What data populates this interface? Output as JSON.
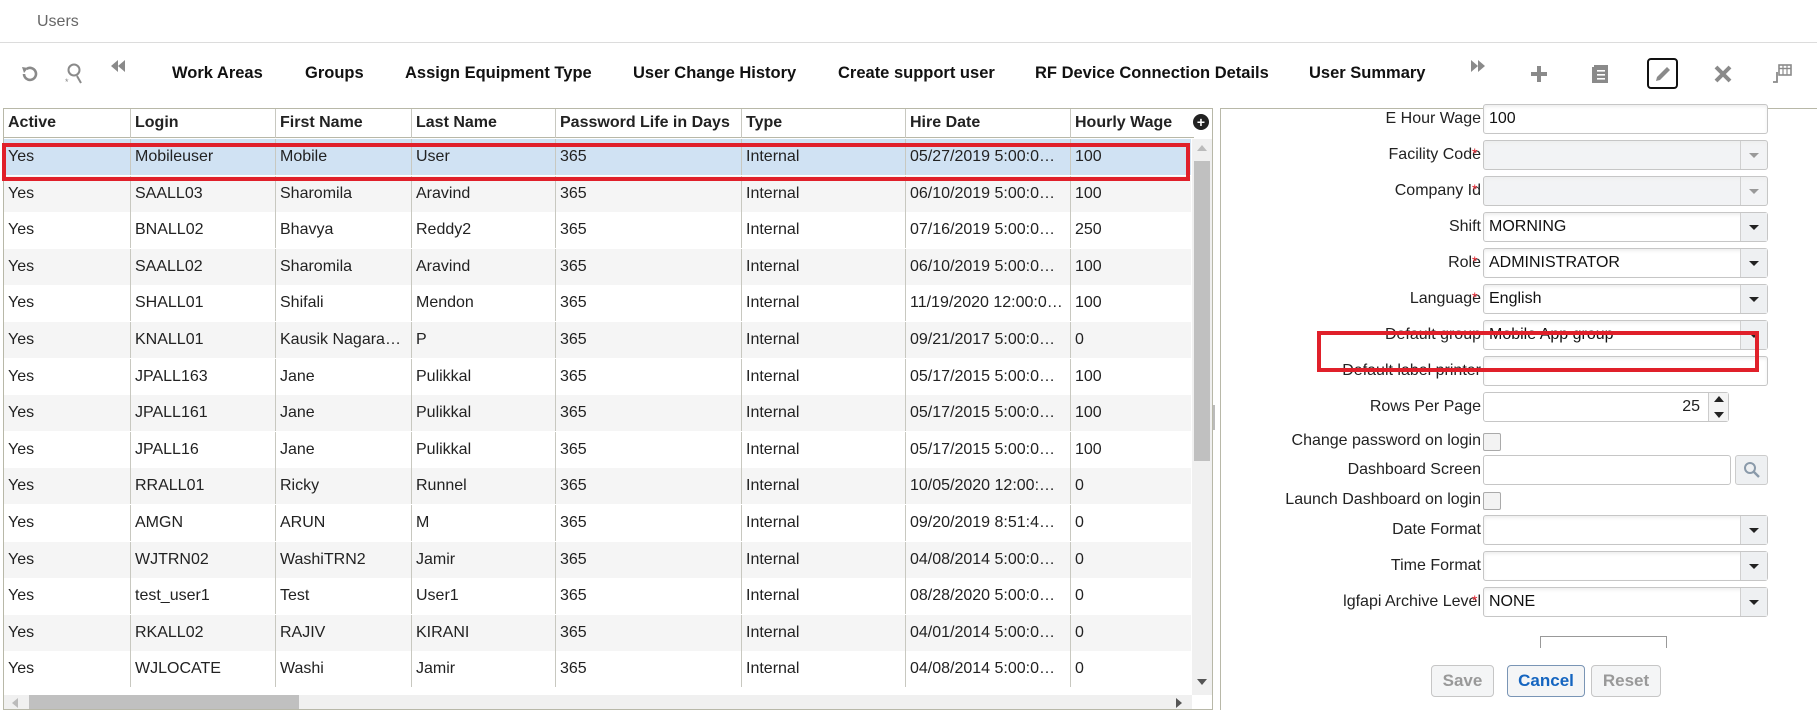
{
  "window": {
    "title": "Users"
  },
  "toolbar": {
    "left_icons": [
      {
        "name": "refresh-icon",
        "glyph": "↻"
      },
      {
        "name": "user-search-icon",
        "glyph": "⚲"
      },
      {
        "name": "scroll-left-icon",
        "glyph": "«"
      }
    ],
    "links": [
      "Work Areas",
      "Groups",
      "Assign Equipment Type",
      "User Change History",
      "Create support user",
      "RF Device Connection Details",
      "User Summary"
    ],
    "right_icons": [
      {
        "name": "scroll-right-icon",
        "glyph": "»"
      },
      {
        "name": "add-icon",
        "glyph": "+"
      },
      {
        "name": "details-icon",
        "glyph": "▤"
      },
      {
        "name": "edit-icon",
        "glyph": "✎",
        "active": true
      },
      {
        "name": "delete-icon",
        "glyph": "✕"
      },
      {
        "name": "grid-export-icon",
        "glyph": "⊞"
      }
    ]
  },
  "grid": {
    "columns": [
      "Active",
      "Login",
      "First Name",
      "Last Name",
      "Password Life in Days",
      "Type",
      "Hire Date",
      "Hourly Wage"
    ],
    "add_column_glyph": "+",
    "selected_row": 0,
    "rows": [
      [
        "Yes",
        "Mobileuser",
        "Mobile",
        "User",
        "365",
        "Internal",
        "05/27/2019 5:00:0…",
        "100"
      ],
      [
        "Yes",
        "SAALL03",
        "Sharomila",
        "Aravind",
        "365",
        "Internal",
        "06/10/2019 5:00:0…",
        "100"
      ],
      [
        "Yes",
        "BNALL02",
        "Bhavya",
        "Reddy2",
        "365",
        "Internal",
        "07/16/2019 5:00:0…",
        "250"
      ],
      [
        "Yes",
        "SAALL02",
        "Sharomila",
        "Aravind",
        "365",
        "Internal",
        "06/10/2019 5:00:0…",
        "100"
      ],
      [
        "Yes",
        "SHALL01",
        "Shifali",
        "Mendon",
        "365",
        "Internal",
        "11/19/2020 12:00:0…",
        "100"
      ],
      [
        "Yes",
        "KNALL01",
        "Kausik Nagara…",
        "P",
        "365",
        "Internal",
        "09/21/2017 5:00:0…",
        "0"
      ],
      [
        "Yes",
        "JPALL163",
        "Jane",
        "Pulikkal",
        "365",
        "Internal",
        "05/17/2015 5:00:0…",
        "100"
      ],
      [
        "Yes",
        "JPALL161",
        "Jane",
        "Pulikkal",
        "365",
        "Internal",
        "05/17/2015 5:00:0…",
        "100"
      ],
      [
        "Yes",
        "JPALL16",
        "Jane",
        "Pulikkal",
        "365",
        "Internal",
        "05/17/2015 5:00:0…",
        "100"
      ],
      [
        "Yes",
        "RRALL01",
        "Ricky",
        "Runnel",
        "365",
        "Internal",
        "10/05/2020 12:00:…",
        "0"
      ],
      [
        "Yes",
        "AMGN",
        "ARUN",
        "M",
        "365",
        "Internal",
        "09/20/2019 8:51:4…",
        "0"
      ],
      [
        "Yes",
        "WJTRN02",
        "WashiTRN2",
        "Jamir",
        "365",
        "Internal",
        "04/08/2014 5:00:0…",
        "0"
      ],
      [
        "Yes",
        "test_user1",
        "Test",
        "User1",
        "365",
        "Internal",
        "08/28/2020 5:00:0…",
        "0"
      ],
      [
        "Yes",
        "RKALL02",
        "RAJIV",
        "KIRANI",
        "365",
        "Internal",
        "04/01/2014 5:00:0…",
        "0"
      ],
      [
        "Yes",
        "WJLOCATE",
        "Washi",
        "Jamir",
        "365",
        "Internal",
        "04/08/2014 5:00:0…",
        "0"
      ]
    ]
  },
  "form": {
    "fields": [
      {
        "label": "E Hour Wage",
        "type": "text",
        "value": "100",
        "required": false
      },
      {
        "label": "Facility Code",
        "type": "select",
        "value": "",
        "required": true,
        "disabled": true
      },
      {
        "label": "Company Id",
        "type": "select",
        "value": "",
        "required": true,
        "disabled": true
      },
      {
        "label": "Shift",
        "type": "select",
        "value": "MORNING",
        "required": false
      },
      {
        "label": "Role",
        "type": "select",
        "value": "ADMINISTRATOR",
        "required": true
      },
      {
        "label": "Language",
        "type": "select",
        "value": "English",
        "required": true
      },
      {
        "label": "Default group",
        "type": "select",
        "value": "Mobile App group",
        "required": false,
        "highlighted": true
      },
      {
        "label": "Default label printer",
        "type": "text",
        "value": "",
        "required": false
      },
      {
        "label": "Rows Per Page",
        "type": "spinner",
        "value": "25",
        "required": false
      },
      {
        "label": "Change password on login",
        "type": "checkbox",
        "checked": false
      },
      {
        "label": "Dashboard Screen",
        "type": "lookup",
        "value": "",
        "required": false
      },
      {
        "label": "Launch Dashboard on login",
        "type": "checkbox",
        "checked": false
      },
      {
        "label": "Date Format",
        "type": "select",
        "value": "",
        "required": false
      },
      {
        "label": "Time Format",
        "type": "select",
        "value": "",
        "required": false
      },
      {
        "label": "lgfapi Archive Level",
        "type": "select",
        "value": "NONE",
        "required": true
      }
    ],
    "required_marker": "*",
    "buttons": {
      "save": "Save",
      "cancel": "Cancel",
      "reset": "Reset"
    }
  },
  "colors": {
    "highlight": "#e0202a",
    "selected_row": "#d0e2f3",
    "primary_button_text": "#1565c0"
  }
}
